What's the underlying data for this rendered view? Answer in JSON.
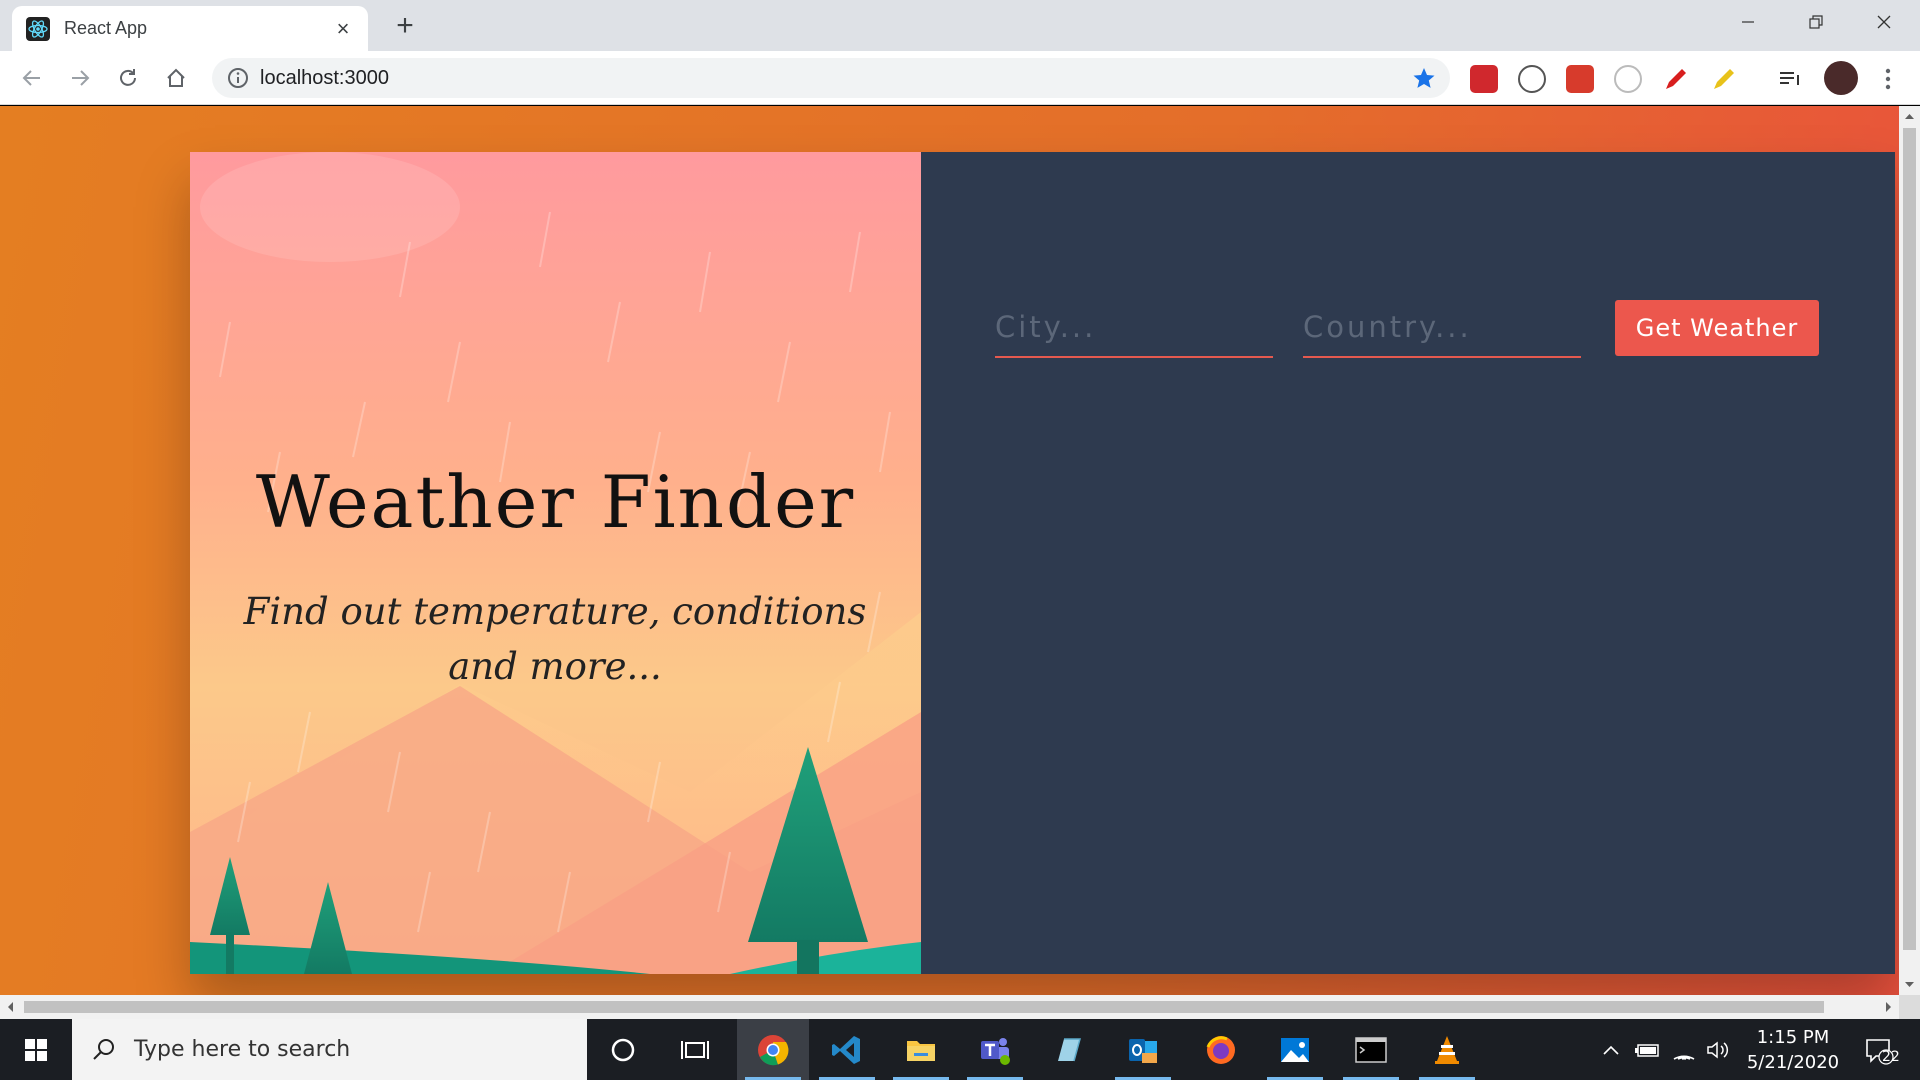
{
  "browser": {
    "tab_title": "React App",
    "url": "localhost:3000",
    "extensions": [
      {
        "name": "adblock-icon",
        "color": "#d0282d"
      },
      {
        "name": "vimeo-icon",
        "color": "#555"
      },
      {
        "name": "extension-red-icon",
        "color": "#d73b2c"
      },
      {
        "name": "extension-circle-icon",
        "color": "#999"
      },
      {
        "name": "pen-red-icon",
        "color": "#d81e1e"
      },
      {
        "name": "highlighter-icon",
        "color": "#e8c21a"
      }
    ]
  },
  "app": {
    "title": "Weather Finder",
    "subtitle": "Find out temperature, conditions and more...",
    "form": {
      "city_placeholder": "City...",
      "country_placeholder": "Country...",
      "submit_label": "Get Weather"
    },
    "colors": {
      "background_start": "#e47e22",
      "background_end": "#e9513d",
      "panel": "#2e3a4f",
      "accent": "#ec574d"
    }
  },
  "taskbar": {
    "search_placeholder": "Type here to search",
    "apps": [
      "cortana",
      "task-view",
      "chrome",
      "vscode",
      "file-explorer",
      "teams",
      "notepad",
      "outlook",
      "firefox",
      "photos",
      "terminal",
      "vlc"
    ],
    "time": "1:15 PM",
    "date": "5/21/2020",
    "notifications": "22"
  }
}
